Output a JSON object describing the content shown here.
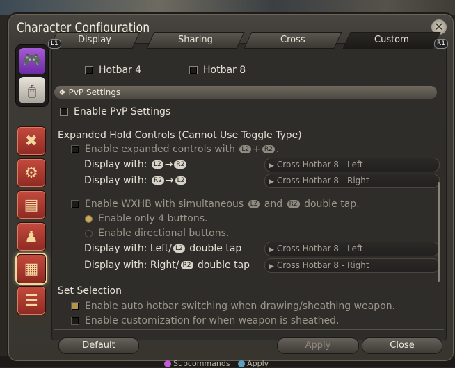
{
  "window": {
    "title": "Character Configuration"
  },
  "tab_hints": {
    "left": "L1",
    "right": "R1"
  },
  "tabs": [
    {
      "label": "Display"
    },
    {
      "label": "Sharing"
    },
    {
      "label": "Cross"
    },
    {
      "label": "Custom",
      "active": true
    }
  ],
  "hotbar_options": [
    "Hotbar 4",
    "Hotbar 8"
  ],
  "pvp": {
    "section_title": "PvP Settings",
    "enable_label": "Enable PvP Settings",
    "enabled": false
  },
  "expanded": {
    "title": "Expanded Hold Controls (Cannot Use Toggle Type)",
    "enable_label_prefix": "Enable expanded controls with",
    "key_a": "L2",
    "plus": "+",
    "key_b": "R2",
    "suffix": ".",
    "display_label": "Display with:",
    "arrow": "→",
    "row1_from": "L2",
    "row1_to": "R2",
    "row1_value": "Cross Hotbar 8 - Left",
    "row2_from": "R2",
    "row2_to": "L2",
    "row2_value": "Cross Hotbar 8 - Right"
  },
  "wxhb": {
    "enable_prefix": "Enable WXHB with simultaneous",
    "key_a": "L2",
    "and": "and",
    "key_b": "R2",
    "suffix": "double tap.",
    "radio1": "Enable only 4 buttons.",
    "radio2": "Enable directional buttons.",
    "row1_prefix": "Display with: Left/",
    "row1_key": "L2",
    "row1_suffix": "double tap",
    "row1_value": "Cross Hotbar 8 - Left",
    "row2_prefix": "Display with: Right/",
    "row2_key": "R2",
    "row2_suffix": "double tap",
    "row2_value": "Cross Hotbar 8 - Right"
  },
  "set_selection": {
    "title": "Set Selection",
    "opt1": "Enable auto hotbar switching when drawing/sheathing weapon.",
    "opt2": "Enable customization for when weapon is sheathed."
  },
  "buttons": {
    "default": "Default",
    "apply": "Apply",
    "close": "Close"
  },
  "dock": {
    "subcommands": "Subcommands",
    "apply": "Apply"
  }
}
